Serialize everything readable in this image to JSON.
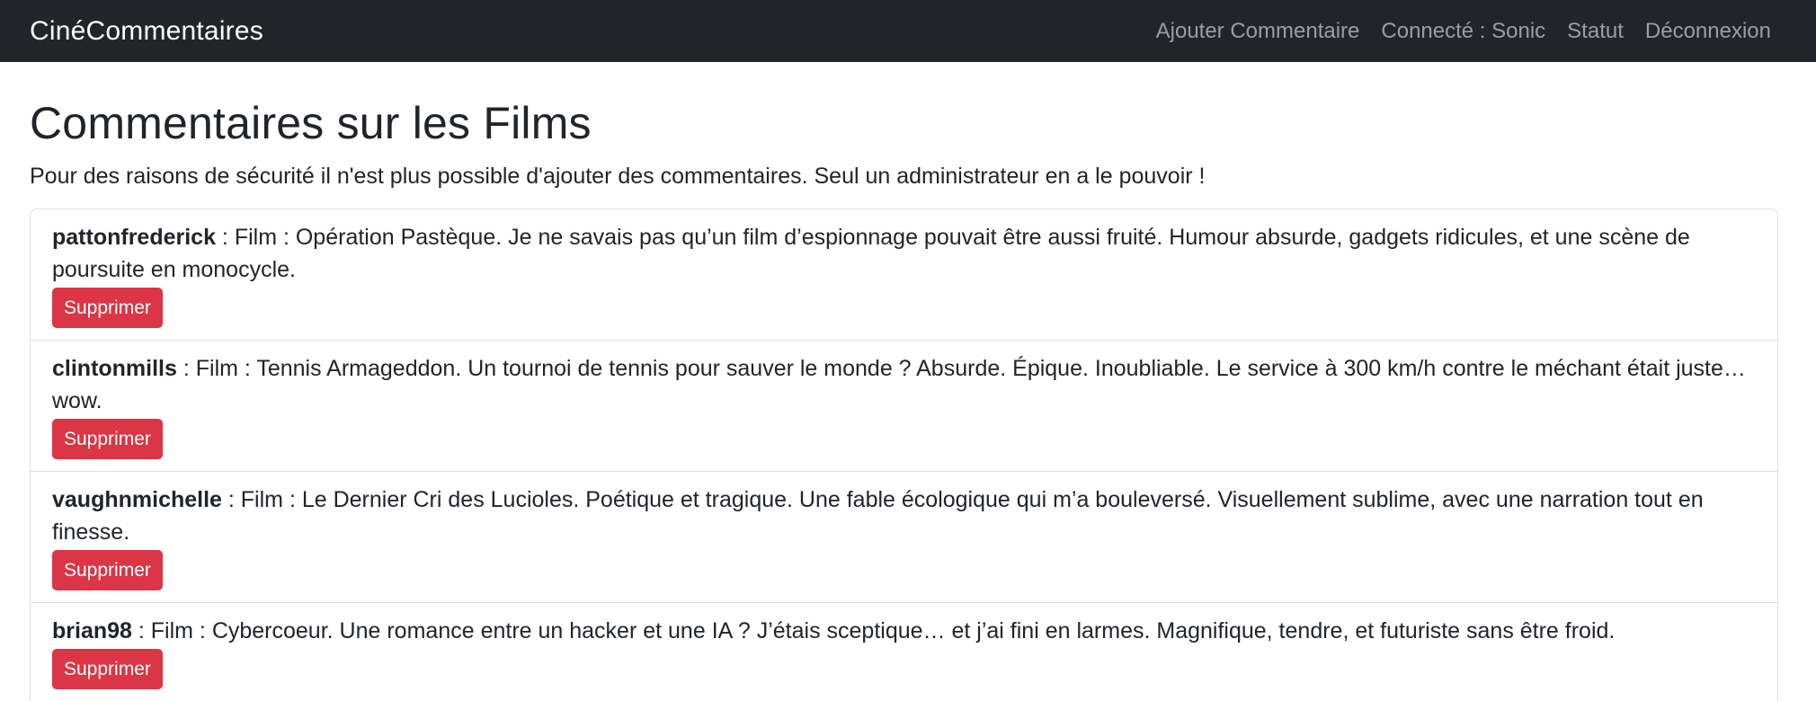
{
  "navbar": {
    "brand": "CinéCommentaires",
    "links": [
      {
        "label": "Ajouter Commentaire"
      },
      {
        "label": "Connecté : Sonic"
      },
      {
        "label": "Statut"
      },
      {
        "label": "Déconnexion"
      }
    ]
  },
  "page": {
    "title": "Commentaires sur les Films",
    "notice": "Pour des raisons de sécurité il n'est plus possible d'ajouter des commentaires. Seul un administrateur en a le pouvoir !"
  },
  "comments": [
    {
      "author": "pattonfrederick",
      "text": " : Film : Opération Pastèque. Je ne savais pas qu’un film d’espionnage pouvait être aussi fruité. Humour absurde, gadgets ridicules, et une scène de poursuite en monocycle.",
      "delete_label": "Supprimer"
    },
    {
      "author": "clintonmills",
      "text": " : Film : Tennis Armageddon. Un tournoi de tennis pour sauver le monde ? Absurde. Épique. Inoubliable. Le service à 300 km/h contre le méchant était juste… wow.",
      "delete_label": "Supprimer"
    },
    {
      "author": "vaughnmichelle",
      "text": " : Film : Le Dernier Cri des Lucioles. Poétique et tragique. Une fable écologique qui m’a bouleversé. Visuellement sublime, avec une narration tout en finesse.",
      "delete_label": "Supprimer"
    },
    {
      "author": "brian98",
      "text": " : Film : Cybercoeur. Une romance entre un hacker et une IA ? J’étais sceptique… et j’ai fini en larmes. Magnifique, tendre, et futuriste sans être froid.",
      "delete_label": "Supprimer"
    }
  ]
}
